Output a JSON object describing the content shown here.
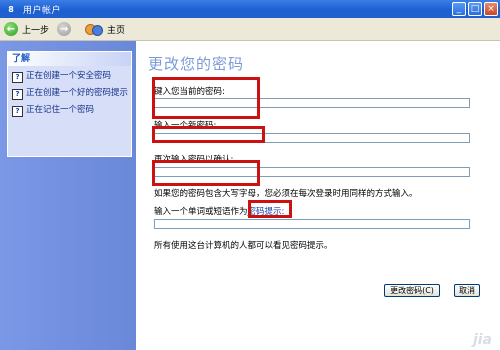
{
  "window": {
    "title": "用户帐户",
    "icon_label": "8"
  },
  "titlebar_buttons": [
    "_",
    "□",
    "×"
  ],
  "nav": {
    "back_label": "上一步",
    "home_label": "主页"
  },
  "learn": {
    "heading": "了解",
    "items": [
      {
        "text": "正在创建一个安全密码"
      },
      {
        "text": "正在创建一个好的密码提示"
      },
      {
        "text": "正在记住一个密码"
      }
    ]
  },
  "main": {
    "heading": "更改您的密码",
    "current_password_label": "键入您当前的密码:",
    "new_password_label": "输入一个新密码:",
    "confirm_password_label": "再次输入密码以确认:",
    "caps_note": "如果您的密码包含大写字母，您必须在每次登录时用同样的方式输入。",
    "hint_label_prefix": "输入一个单词或短语作为",
    "hint_link": "密码提示:",
    "hint_note": "所有使用这台计算机的人都可以看见密码提示。",
    "change_button": "更改密码(C)",
    "cancel_button": "取消"
  },
  "watermark": "jia"
}
